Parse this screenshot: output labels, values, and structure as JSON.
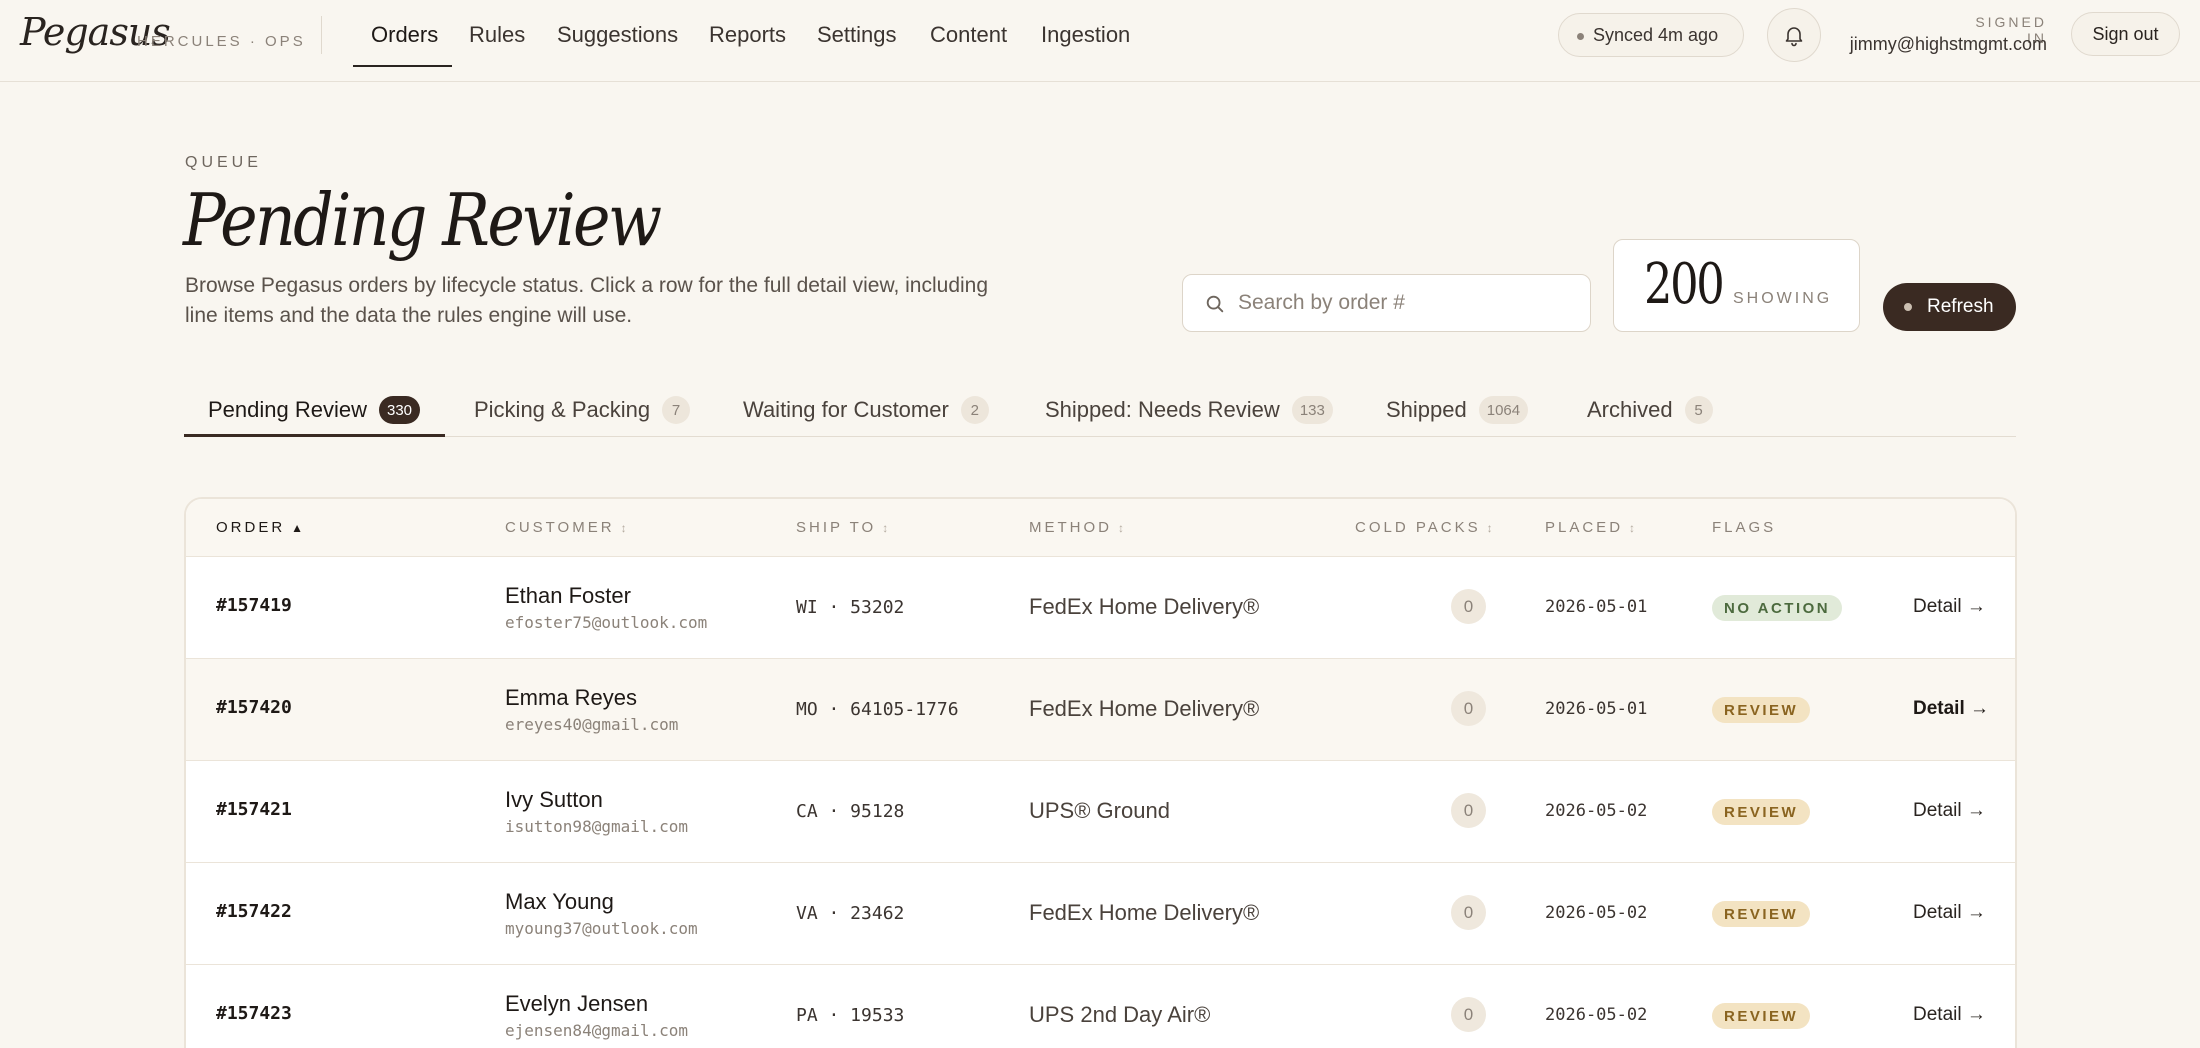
{
  "nav": {
    "brand": "Pegasus",
    "brand_sub": "HERCULES · OPS",
    "items": [
      {
        "label": "Orders"
      },
      {
        "label": "Rules"
      },
      {
        "label": "Suggestions"
      },
      {
        "label": "Reports"
      },
      {
        "label": "Settings"
      },
      {
        "label": "Content"
      },
      {
        "label": "Ingestion"
      }
    ],
    "sync_status": "Synced 4m ago",
    "signed_in_label": "SIGNED IN",
    "user_email": "jimmy@highstmgmt.com",
    "signout_label": "Sign out"
  },
  "header": {
    "eyebrow": "QUEUE",
    "title": "Pending Review",
    "description": "Browse Pegasus orders by lifecycle status. Click a row for the full detail view, including line items and the data the rules engine will use.",
    "search_placeholder": "Search by order #",
    "showing_count": "200",
    "showing_label": "SHOWING",
    "refresh_label": "Refresh"
  },
  "tabs": [
    {
      "label": "Pending Review",
      "count": "330"
    },
    {
      "label": "Picking & Packing",
      "count": "7"
    },
    {
      "label": "Waiting for Customer",
      "count": "2"
    },
    {
      "label": "Shipped: Needs Review",
      "count": "133"
    },
    {
      "label": "Shipped",
      "count": "1064"
    },
    {
      "label": "Archived",
      "count": "5"
    }
  ],
  "table": {
    "columns": [
      {
        "label": "ORDER",
        "sort": "▲"
      },
      {
        "label": "CUSTOMER",
        "sort": "↕"
      },
      {
        "label": "SHIP TO",
        "sort": "↕"
      },
      {
        "label": "METHOD",
        "sort": "↕"
      },
      {
        "label": "COLD PACKS",
        "sort": "↕"
      },
      {
        "label": "PLACED",
        "sort": "↕"
      },
      {
        "label": "FLAGS",
        "sort": ""
      }
    ],
    "rows": [
      {
        "order": "#157419",
        "name": "Ethan Foster",
        "email": "efoster75@outlook.com",
        "ship": "WI · 53202",
        "method": "FedEx Home Delivery®",
        "cold": "0",
        "placed": "2026-05-01",
        "flag": "NO ACTION",
        "flag_type": "noaction",
        "detail": "Detail →"
      },
      {
        "order": "#157420",
        "name": "Emma Reyes",
        "email": "ereyes40@gmail.com",
        "ship": "MO · 64105-1776",
        "method": "FedEx Home Delivery®",
        "cold": "0",
        "placed": "2026-05-01",
        "flag": "REVIEW",
        "flag_type": "review",
        "detail": "Detail →"
      },
      {
        "order": "#157421",
        "name": "Ivy Sutton",
        "email": "isutton98@gmail.com",
        "ship": "CA · 95128",
        "method": "UPS® Ground",
        "cold": "0",
        "placed": "2026-05-02",
        "flag": "REVIEW",
        "flag_type": "review",
        "detail": "Detail →"
      },
      {
        "order": "#157422",
        "name": "Max Young",
        "email": "myoung37@outlook.com",
        "ship": "VA · 23462",
        "method": "FedEx Home Delivery®",
        "cold": "0",
        "placed": "2026-05-02",
        "flag": "REVIEW",
        "flag_type": "review",
        "detail": "Detail →"
      },
      {
        "order": "#157423",
        "name": "Evelyn Jensen",
        "email": "ejensen84@gmail.com",
        "ship": "PA · 19533",
        "method": "UPS 2nd Day Air®",
        "cold": "0",
        "placed": "2026-05-02",
        "flag": "REVIEW",
        "flag_type": "review",
        "detail": "Detail →"
      }
    ]
  }
}
